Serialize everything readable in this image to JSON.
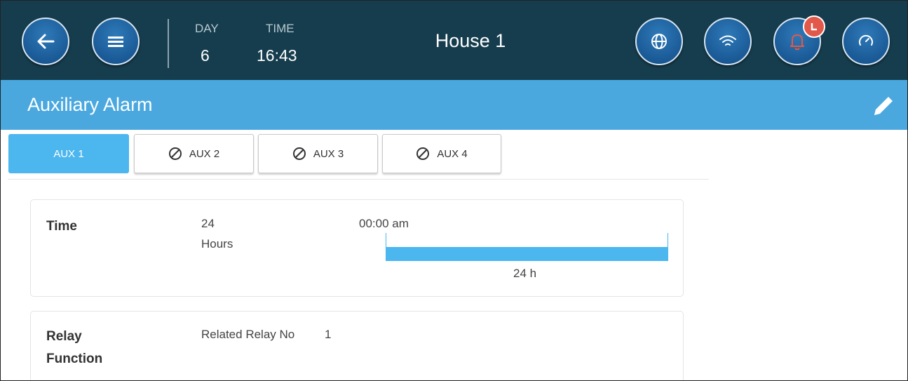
{
  "topbar": {
    "day_label": "DAY",
    "day_value": "6",
    "time_label": "TIME",
    "time_value": "16:43",
    "house": "House 1"
  },
  "page": {
    "title": "Auxiliary Alarm"
  },
  "tabs": [
    {
      "label": "AUX 1",
      "active": true,
      "disabled": false
    },
    {
      "label": "AUX 2",
      "active": false,
      "disabled": true
    },
    {
      "label": "AUX 3",
      "active": false,
      "disabled": true
    },
    {
      "label": "AUX 4",
      "active": false,
      "disabled": true
    }
  ],
  "time_card": {
    "label": "Time",
    "duration_value": "24",
    "duration_unit": "Hours",
    "start_time": "00:00 am",
    "bar_label": "24 h"
  },
  "relay_card": {
    "label_line1": "Relay",
    "label_line2": "Function",
    "relay_label": "Related Relay No",
    "relay_value": "1"
  },
  "colors": {
    "topbar": "#163d4d",
    "titlebar": "#4aa8df",
    "accent": "#4cb6ee",
    "alarm_badge": "#e2584a"
  },
  "icons": [
    "back-arrow-icon",
    "menu-icon",
    "globe-icon",
    "wifi-icon",
    "bell-icon",
    "gauge-icon",
    "pencil-icon",
    "disabled-icon"
  ]
}
